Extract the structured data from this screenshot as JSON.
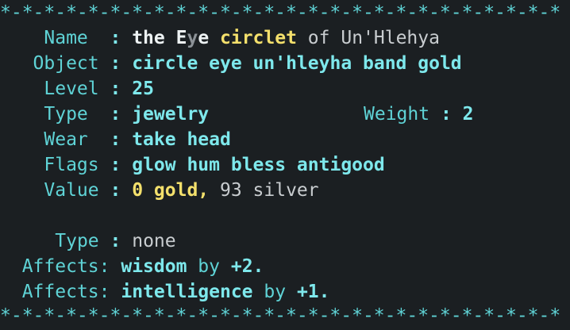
{
  "separator": "*-*-*-*-*-*-*-*-*-*-*-*-*-*-*-*-*-*-*-*-*-*-*-*-*-*",
  "colon": ":",
  "name": {
    "label": "Name",
    "parts": [
      "the ",
      "E",
      "y",
      "e ",
      "circlet",
      " of Un'Hlehya"
    ]
  },
  "object": {
    "label": "Object",
    "value": "circle eye un'hleyha band gold"
  },
  "level": {
    "label": "Level",
    "value": "25"
  },
  "type": {
    "label": "Type",
    "value": "jewelry",
    "weight_label": "Weight",
    "weight_value": "2"
  },
  "wear": {
    "label": "Wear",
    "value": "take head"
  },
  "flags": {
    "label": "Flags",
    "value": "glow hum bless antigood"
  },
  "value": {
    "label": "Value",
    "gold": "0 gold,",
    "silver": " 93 silver"
  },
  "affects_type": {
    "label": "Type",
    "value": "none"
  },
  "affects": [
    {
      "label": "Affects:",
      "stat": "wisdom",
      "by": "by",
      "amount": "+2."
    },
    {
      "label": "Affects:",
      "stat": "intelligence",
      "by": "by",
      "amount": "+1."
    }
  ],
  "colors": {
    "background": "#1b1f22",
    "label_cyan": "#5fd3d6",
    "value_cyan": "#7ee8ec",
    "gold_yellow": "#f4e06c"
  }
}
